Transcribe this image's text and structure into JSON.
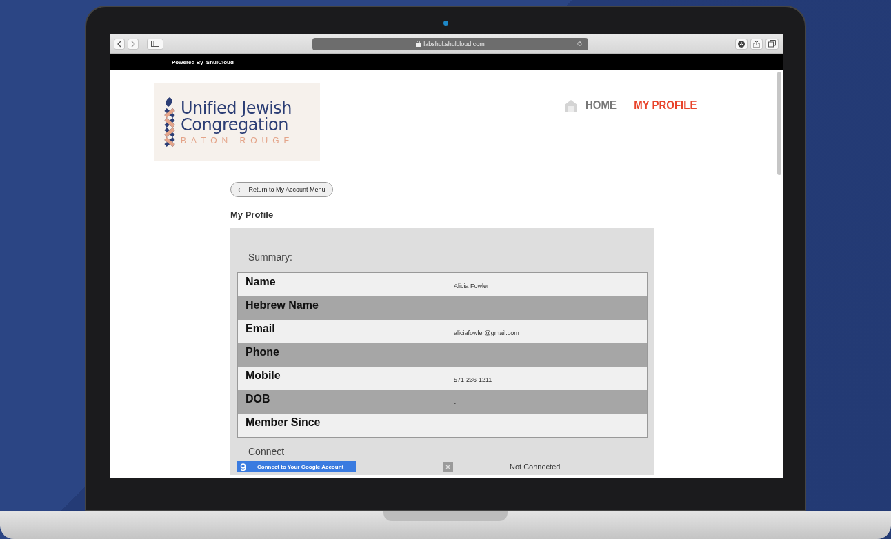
{
  "browser": {
    "url": "labshul.shulcloud.com"
  },
  "top_bar": {
    "powered_by": "Powered By",
    "link": "ShulCloud"
  },
  "logo": {
    "line_1": "Unified Jewish",
    "line_2": "Congregation",
    "line_3": "BATON ROUGE"
  },
  "nav": [
    {
      "label": "HOME",
      "selected": false
    },
    {
      "label": "MY PROFILE",
      "selected": true
    }
  ],
  "back_button": "⟵ Return to My Account Menu",
  "heading": "My Profile",
  "summary": {
    "title": "Summary:",
    "rows": [
      {
        "label": "Name",
        "value": "Alicia Fowler"
      },
      {
        "label": "Hebrew Name",
        "value": ""
      },
      {
        "label": "Email",
        "value": "aliciafowler@gmail.com"
      },
      {
        "label": "Phone",
        "value": ""
      },
      {
        "label": "Mobile",
        "value": "571-236-1211"
      },
      {
        "label": "DOB",
        "value": "-"
      },
      {
        "label": "Member Since",
        "value": "-"
      }
    ]
  },
  "connect": {
    "title": "Connect",
    "google_button": "Connect to Your Google Account",
    "status": "Not Connected"
  }
}
